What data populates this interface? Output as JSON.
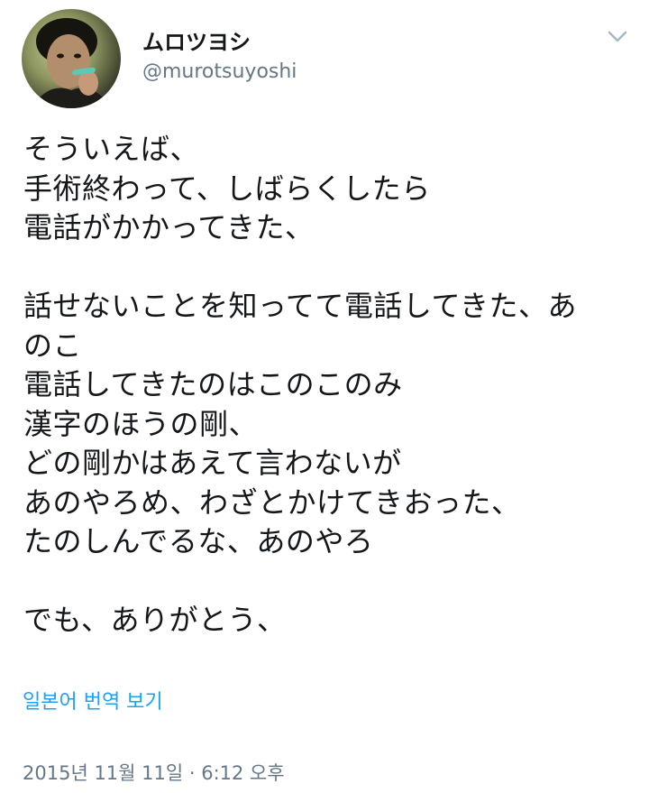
{
  "user": {
    "display_name": "ムロツヨシ",
    "handle": "@murotsuyoshi"
  },
  "icons": {
    "menu": "chevron-down-icon",
    "avatar": "profile-photo"
  },
  "tweet": {
    "lines": [
      "そういえば、",
      "手術終わって、しばらくしたら",
      "電話がかかってきた、",
      "",
      "話せないことを知ってて電話してきた、あ",
      "のこ",
      "電話してきたのはこのこのみ",
      "漢字のほうの剛、",
      "どの剛かはあえて言わないが",
      "あのやろめ、わざとかけてきおった、",
      "たのしんでるな、あのやろ",
      "",
      "でも、ありがとう、"
    ]
  },
  "translate_label": "일본어 번역 보기",
  "timestamp": "2015년 11월 11일 · 6:12 오후",
  "colors": {
    "text": "#14171a",
    "secondary": "#657786",
    "link": "#1da1f2"
  }
}
